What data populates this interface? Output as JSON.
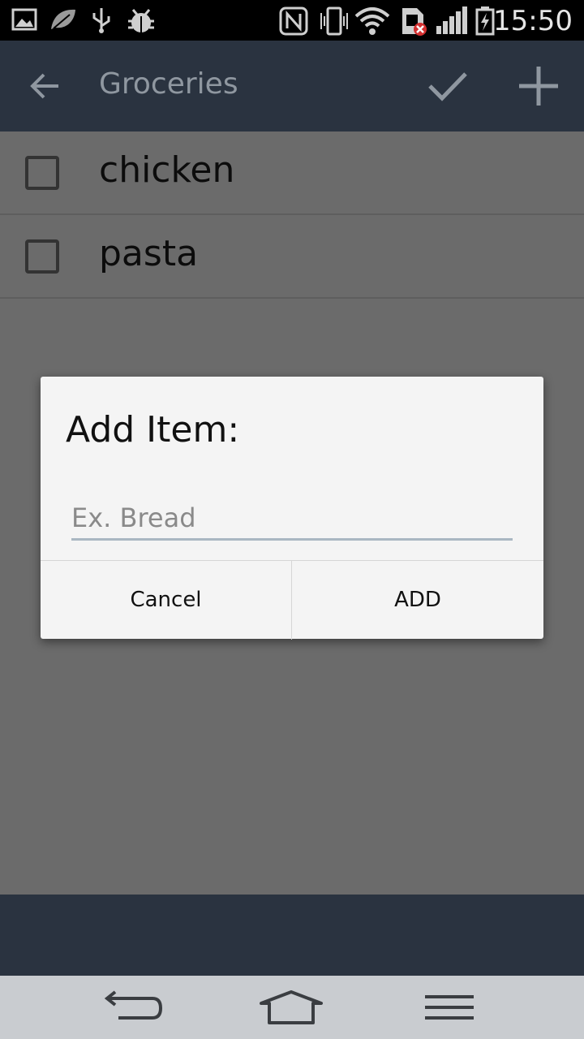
{
  "status_bar": {
    "time": "15:50",
    "icons": [
      "gallery-icon",
      "leaf-icon",
      "usb-icon",
      "android-debug-icon",
      "nfc-icon",
      "vibrate-icon",
      "wifi-icon",
      "sim-error-icon",
      "signal-icon",
      "battery-charging-icon"
    ]
  },
  "app_bar": {
    "title": "Groceries",
    "icons": [
      "back-arrow-icon",
      "check-icon",
      "plus-icon"
    ]
  },
  "list": {
    "items": [
      {
        "label": "chicken",
        "checked": false
      },
      {
        "label": "pasta",
        "checked": false
      }
    ]
  },
  "dialog": {
    "title": "Add Item:",
    "input_placeholder": "Ex. Bread",
    "input_value": "",
    "cancel_label": "Cancel",
    "add_label": "ADD"
  },
  "nav_bar": {
    "icons": [
      "back-nav-icon",
      "home-nav-icon",
      "menu-nav-icon"
    ]
  },
  "colors": {
    "app_bar": "#2a3340",
    "overlay_content": "#6b6b6b",
    "dialog_bg": "#f4f4f4",
    "input_underline": "#a9b7c2",
    "nav_bar": "#c9ccd0"
  }
}
